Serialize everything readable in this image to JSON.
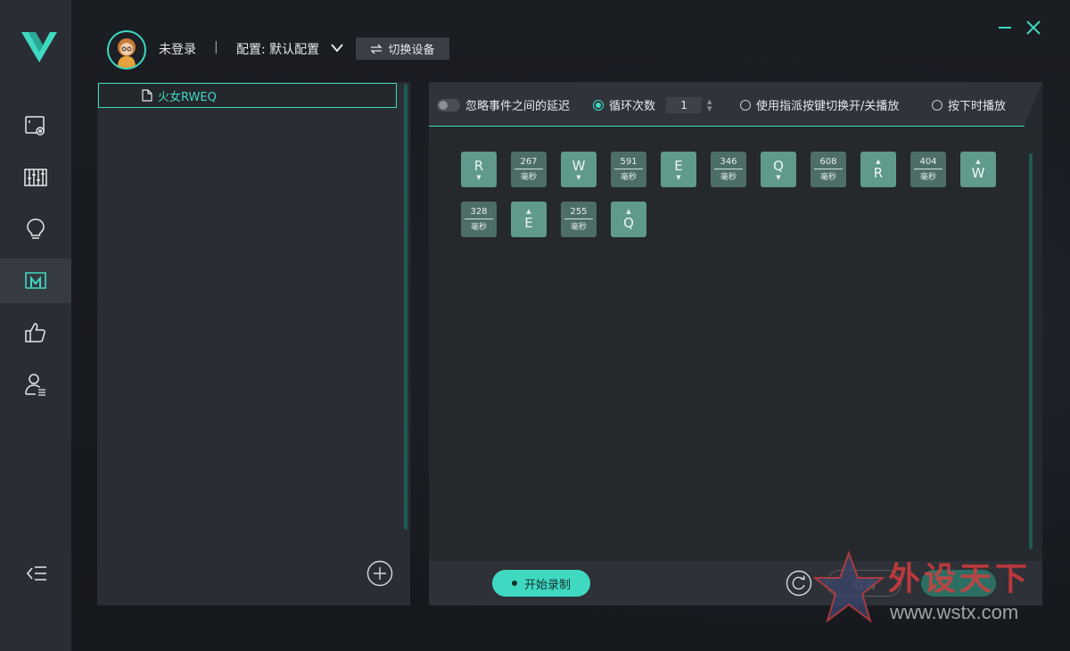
{
  "header": {
    "user_status": "未登录",
    "separator": "|",
    "config_label": "配置: 默认配置",
    "switch_device": "切换设备"
  },
  "sidebar": {
    "items": [
      {
        "icon": "display-settings-icon"
      },
      {
        "icon": "equalizer-icon"
      },
      {
        "icon": "light-bulb-icon"
      },
      {
        "icon": "macro-icon",
        "active": true
      },
      {
        "icon": "thumbs-up-icon"
      },
      {
        "icon": "user-account-icon"
      }
    ]
  },
  "macro_list": {
    "items": [
      {
        "name": "火女RWEQ"
      }
    ]
  },
  "toolbar": {
    "ignore_delay": "忽略事件之间的延迟",
    "loop_count": "循环次数",
    "loop_value": "1",
    "assign_toggle": "使用指派按键切换开/关播放",
    "play_while_pressed": "按下时播放"
  },
  "events": [
    {
      "type": "key",
      "label": "R",
      "dir": "▼"
    },
    {
      "type": "delay",
      "value": "267",
      "unit": "毫秒"
    },
    {
      "type": "key",
      "label": "W",
      "dir": "▼"
    },
    {
      "type": "delay",
      "value": "591",
      "unit": "毫秒"
    },
    {
      "type": "key",
      "label": "E",
      "dir": "▼"
    },
    {
      "type": "delay",
      "value": "346",
      "unit": "毫秒"
    },
    {
      "type": "key",
      "label": "Q",
      "dir": "▼"
    },
    {
      "type": "delay",
      "value": "608",
      "unit": "毫秒"
    },
    {
      "type": "key",
      "label": "R",
      "dir": "▲"
    },
    {
      "type": "delay",
      "value": "404",
      "unit": "毫秒"
    },
    {
      "type": "key",
      "label": "W",
      "dir": "▲"
    },
    {
      "type": "delay",
      "value": "328",
      "unit": "毫秒"
    },
    {
      "type": "key",
      "label": "E",
      "dir": "▲"
    },
    {
      "type": "delay",
      "value": "255",
      "unit": "毫秒"
    },
    {
      "type": "key",
      "label": "Q",
      "dir": "▲"
    }
  ],
  "bottom": {
    "record": "开始录制",
    "cancel": "取消"
  },
  "watermark": {
    "text": "外设天下",
    "url": "www.wstx.com"
  },
  "colors": {
    "accent": "#3fd9c2",
    "key_bg": "#5f9a8c",
    "delay_bg": "#4d6e67"
  }
}
